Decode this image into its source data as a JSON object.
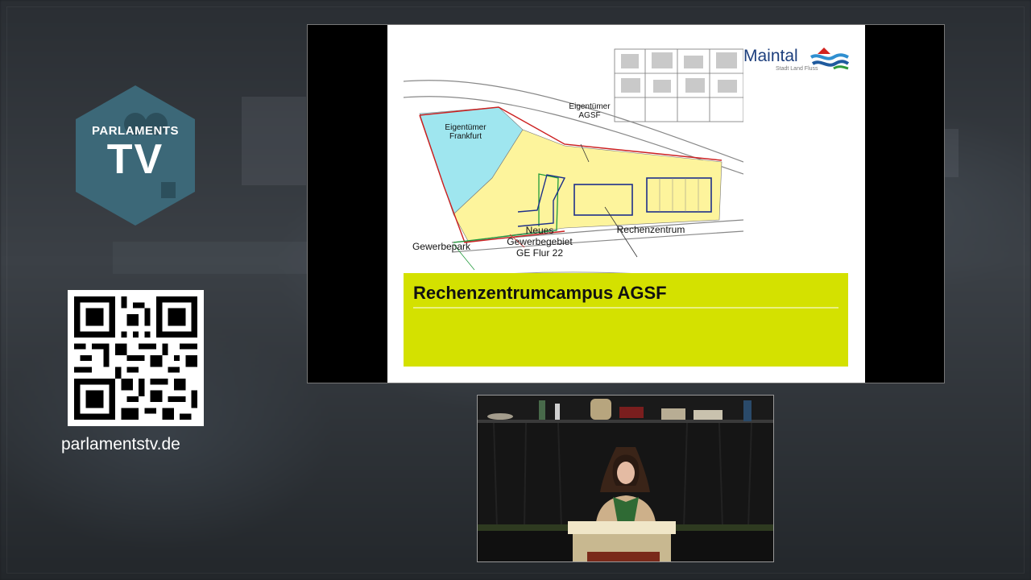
{
  "channel": {
    "logo_top": "PARLAMENTS",
    "logo_main": "TV",
    "website": "parlamentstv.de",
    "hex_color": "#3c6878"
  },
  "qr": {
    "description": "qr-code"
  },
  "slide": {
    "brand": {
      "name": "Maintal",
      "tagline": "Stadt Land Fluss"
    },
    "map_labels": {
      "owner_agsf_line1": "Eigentümer",
      "owner_agsf_line2": "AGSF",
      "owner_frankfurt_line1": "Eigentümer",
      "owner_frankfurt_line2": "Frankfurt",
      "business_park": "Gewerbepark",
      "new_area_line1": "Neues",
      "new_area_line2": "Gewerbegebiet",
      "new_area_line3": "GE Flur 22",
      "data_center": "Rechenzentrum"
    },
    "title": "Rechenzentrumcampus AGSF",
    "colors": {
      "title_box": "#d4e100",
      "area_yellow": "#fdf49c",
      "area_cyan": "#9fe6ef",
      "border_red": "#cc1f1f",
      "border_green": "#1f9a3a",
      "outline_blue": "#1d2f8a"
    }
  }
}
